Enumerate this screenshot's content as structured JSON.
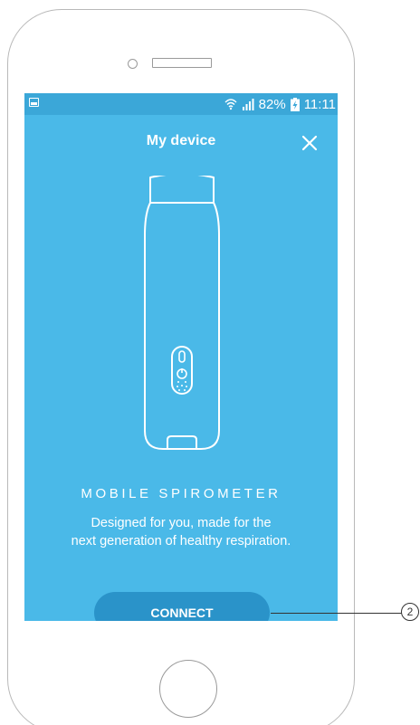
{
  "status_bar": {
    "battery_percent": "82%",
    "time": "11:11"
  },
  "header": {
    "title": "My device",
    "close_icon": "close-icon"
  },
  "product": {
    "title": "MOBILE SPIROMETER",
    "description_line1": "Designed for you, made for the",
    "description_line2": "next generation of healthy respiration."
  },
  "actions": {
    "connect_label": "CONNECT"
  },
  "annotation": {
    "callout_number": "2"
  },
  "colors": {
    "screen_background": "#4ab9e8",
    "status_bar": "#3ba7d8",
    "button": "#2a93c9",
    "text": "#ffffff"
  }
}
